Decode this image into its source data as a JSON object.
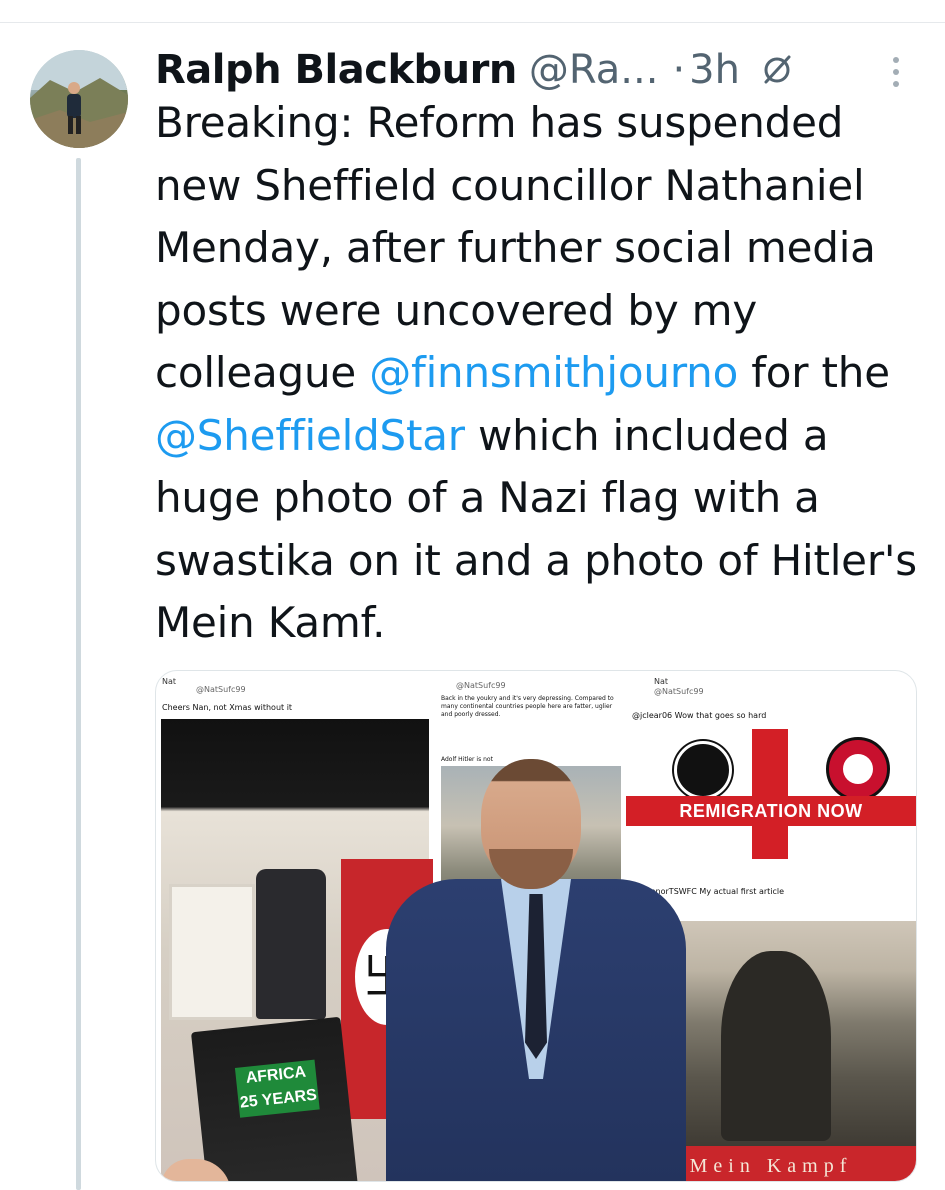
{
  "tweet": {
    "author_name": "Ralph Blackburn",
    "author_handle": "@Ra...",
    "separator": "·",
    "time": "3h",
    "body_parts": [
      {
        "text": "Breaking: Reform has suspended new Sheffield councillor Nathaniel Menday,  after further social media posts were uncovered by my colleague ",
        "type": "text"
      },
      {
        "text": "@finnsmithjourno",
        "type": "mention"
      },
      {
        "text": " for the ",
        "type": "text"
      },
      {
        "text": "@SheffieldStar",
        "type": "mention"
      },
      {
        "text": " which included a huge photo of a Nazi flag with a swastika on it and a photo of Hitler's Mein Kamf.",
        "type": "text"
      }
    ]
  },
  "icons": {
    "grok": "grok-icon",
    "more": "more-vertical-icon"
  },
  "colors": {
    "link": "#1d9bf0",
    "secondary_text": "#536471",
    "thread_line": "#cfd9de"
  },
  "media": {
    "left_panel": {
      "user_line": "Nat",
      "handle": "@NatSufc99",
      "text": "Cheers Nan, not Xmas without it",
      "box_text": "AFRICA 25 YEARS"
    },
    "middle_panel": {
      "handle": "@NatSufc99",
      "text": "Back in the youkry and it's very depressing. Compared to many continental countries people here are fatter, uglier and poorly dressed.",
      "reply_text": "Adolf Hitler is not"
    },
    "right_panel": {
      "user_line": "Nat",
      "handle": "@NatSufc99",
      "reply_text": "@jclear06 Wow that goes so hard",
      "banner": "REMIGRATION NOW",
      "second_reply": "@ConnorTSWFC My actual first article",
      "book_title": "Mein Kampf"
    }
  }
}
